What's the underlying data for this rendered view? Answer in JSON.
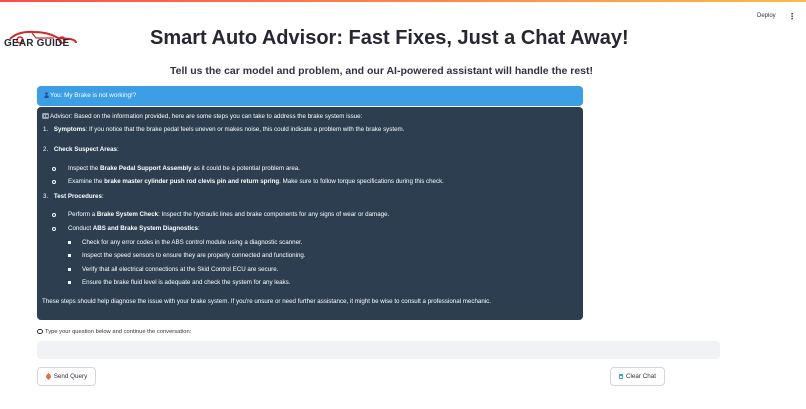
{
  "header": {
    "deploy_label": "Deploy",
    "menu_icon": "kebab-menu-icon"
  },
  "logo": {
    "text": "GEAR GUIDE",
    "icon": "car-silhouette-icon",
    "colors": {
      "car": "#cc2b2b",
      "text": "#262730"
    }
  },
  "main": {
    "title": "Smart Auto Advisor: Fast Fixes, Just a Chat Away!",
    "subtitle": "Tell us the car model and problem, and our AI-powered assistant will handle the rest!"
  },
  "chat": {
    "user_message": "You: My Brake is not working!?",
    "user_icon": "user-icon",
    "advisor_icon": "robot-icon",
    "advisor": {
      "intro": "Advisor: Based on the information provided, here are some steps you can take to address the brake system issue:",
      "item1": {
        "num": "1.",
        "bold": "Symptoms",
        "rest": ": If you notice that the brake pedal feels uneven or makes noise, this could indicate a problem with the brake system."
      },
      "item2": {
        "num": "2.",
        "bold": "Check Suspect Areas",
        "rest": ":"
      },
      "item2_a": {
        "pre": "Inspect the ",
        "bold": "Brake Pedal Support Assembly",
        "post": " as it could be a potential problem area."
      },
      "item2_b": {
        "pre": "Examine the ",
        "bold": "brake master cylinder push rod clevis pin and return spring",
        "post": ". Make sure to follow torque specifications during this check."
      },
      "item3": {
        "num": "3.",
        "bold": "Test Procedures",
        "rest": ":"
      },
      "item3_a": {
        "pre": "Perform a ",
        "bold": "Brake System Check",
        "post": ": Inspect the hydraulic lines and brake components for any signs of wear or damage."
      },
      "item3_b": {
        "pre": "Conduct ",
        "bold": "ABS and Brake System Diagnostics",
        "post": ":"
      },
      "sub1": "Check for any error codes in the ABS control module using a diagnostic scanner.",
      "sub2": "Inspect the speed sensors to ensure they are properly connected and functioning.",
      "sub3": "Verify that all electrical connections at the Skid Control ECU are secure.",
      "sub4": "Ensure the brake fluid level is adequate and check the system for any leaks.",
      "closing": "These steps should help diagnose the issue with your brake system. If you're unsure or need further assistance, it might be wise to consult a professional mechanic."
    },
    "colors": {
      "user_bubble": "#3c9ee5",
      "advisor_bubble": "#2c3e50"
    }
  },
  "input": {
    "hint": "Type your question below and continue the conversation:",
    "hint_icon": "speech-bubble-icon",
    "value": "",
    "placeholder": ""
  },
  "buttons": {
    "send_label": "Send Query",
    "send_icon": "rocket-icon",
    "clear_label": "Clear Chat",
    "clear_icon": "trash-icon"
  }
}
